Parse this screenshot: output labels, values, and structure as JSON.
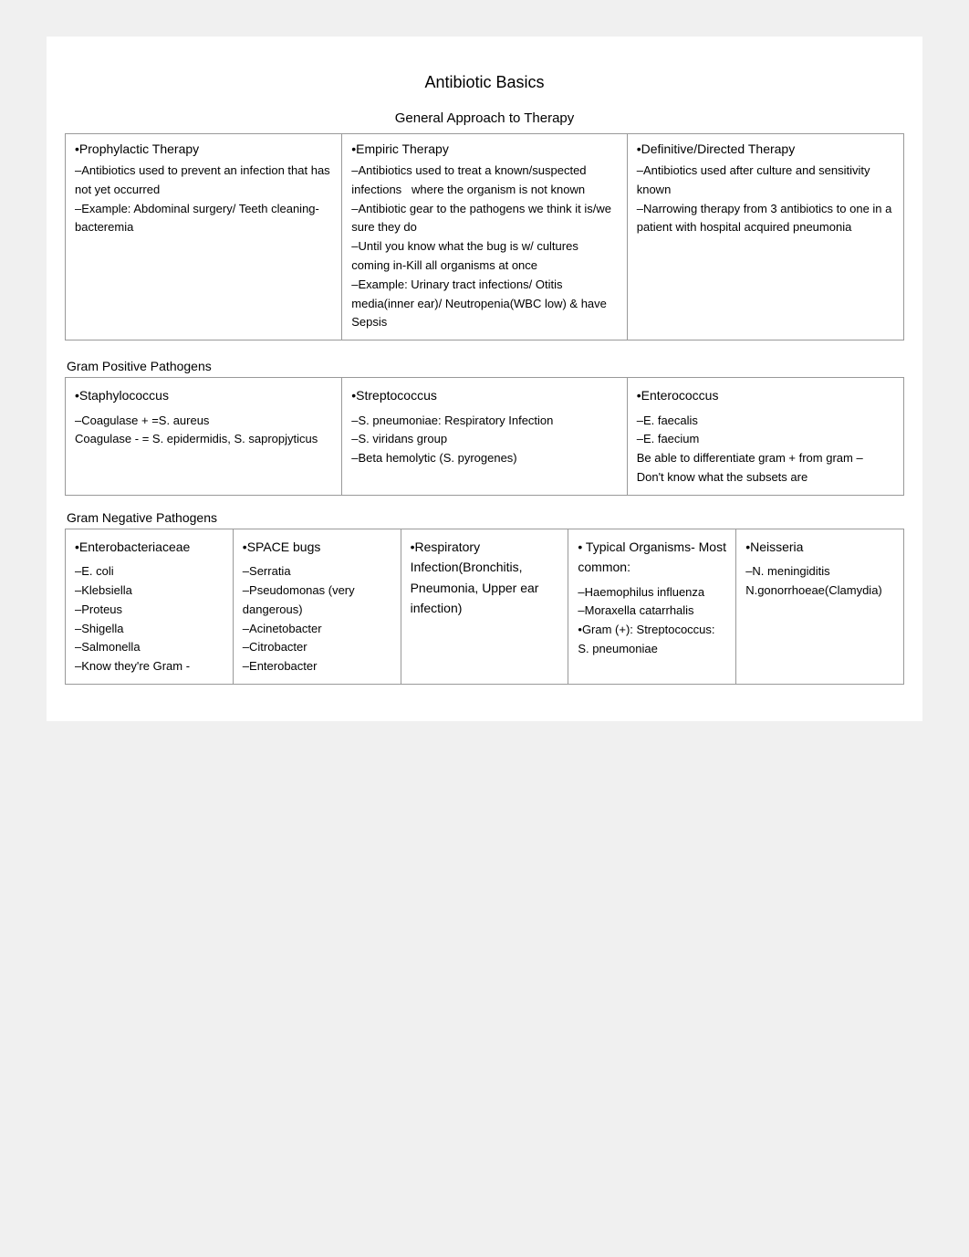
{
  "page": {
    "title": "Antibiotic Basics",
    "general_approach": "General Approach to Therapy",
    "therapy_columns": [
      {
        "header": "•Prophylactic Therapy",
        "content": "–Antibiotics used to prevent  an infection that has  not yet occurred\n–Example: Abdominal surgery/ Teeth cleaning-bacteremia"
      },
      {
        "header": "•Empiric Therapy",
        "content": "–Antibiotics used to treat a known/suspected infections    where the organism is not known\n–Antibiotic gear to the pathogens we think it is/we sure they do\n–Until you know what the bug is w/ cultures coming in-Kill all organisms at once\n–Example: Urinary tract infections/ Otitis media(inner ear)/ Neutropenia(WBC low) & have Sepsis"
      },
      {
        "header": "•Definitive/Directed Therapy",
        "content": "–Antibiotics used after culture and  sensitivity known\n–Narrowing therapy  from 3 antibiotics  to  one  in a patient with hospital acquired pneumonia"
      }
    ],
    "gram_positive": {
      "label": "Gram Positive Pathogens",
      "columns": [
        {
          "header": "•Staphylococcus",
          "content": "–Coagulase + =S. aureus\nCoagulase - = S. epidermidis, S. sapropjyticus"
        },
        {
          "header": "•Streptococcus",
          "content": "–S. pneumoniae:  Respiratory Infection\n–S. viridans group\n–Beta hemolytic (S. pyrogenes)"
        },
        {
          "header": "•Enterococcus",
          "content": "–E. faecalis\n–E. faecium\nBe able to differentiate gram + from gram –\nDon't know what the subsets are"
        }
      ]
    },
    "gram_negative": {
      "label": "Gram Negative Pathogens",
      "columns": [
        {
          "header": "•Enterobacteriaceae",
          "content": "–E. coli\n–Klebsiella\n–Proteus\n–Shigella\n–Salmonella\n–Know they're Gram -"
        },
        {
          "header": "•SPACE bugs",
          "content": "–Serratia\n–Pseudomonas (very dangerous)\n–Acinetobacter\n–Citrobacter\n–Enterobacter"
        },
        {
          "header": "•Respiratory Infection(Bronchitis, Pneumonia, Upper ear infection)",
          "content": ""
        },
        {
          "header": "• Typical Organisms- Most common:",
          "content": "–Haemophilus influenza\n–Moraxella catarrhalis\n•Gram (+): Streptococcus:  S. pneumoniae"
        },
        {
          "header": "•Neisseria",
          "content": "–N. meningiditis\nN.gonorrhoeae(Clamydia)"
        }
      ]
    }
  }
}
